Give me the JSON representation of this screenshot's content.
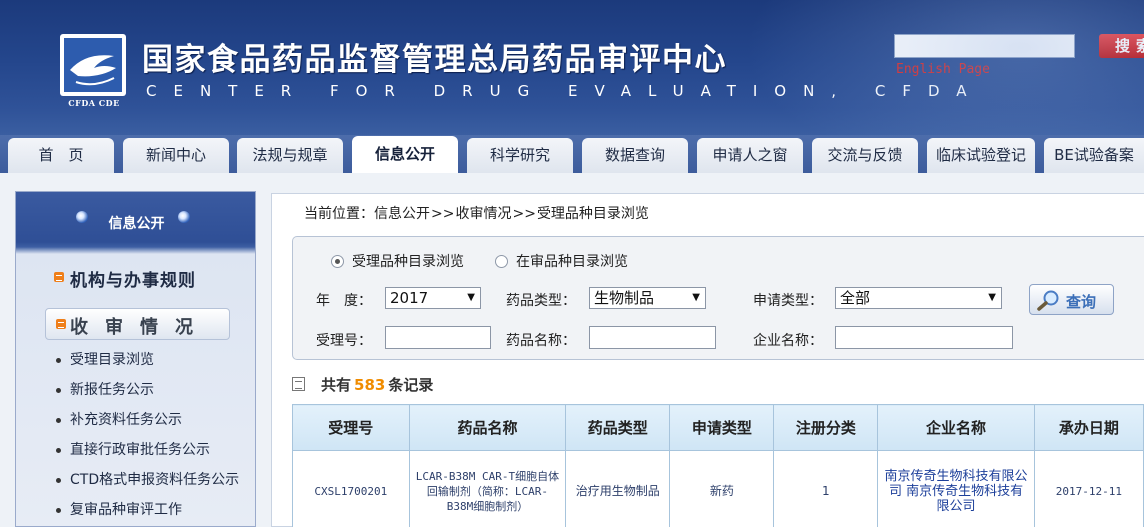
{
  "header": {
    "title": "国家食品药品监督管理总局药品审评中心",
    "subtitle": "CENTER FOR DRUG EVALUATION, CFDA",
    "logo_caption": "CFDA CDE",
    "search_placeholder": "",
    "search_button": "搜索",
    "english_link": "English Page"
  },
  "nav": {
    "items": [
      {
        "label": "首　页"
      },
      {
        "label": "新闻中心"
      },
      {
        "label": "法规与规章"
      },
      {
        "label": "信息公开"
      },
      {
        "label": "科学研究"
      },
      {
        "label": "数据查询"
      },
      {
        "label": "申请人之窗"
      },
      {
        "label": "交流与反馈"
      },
      {
        "label": "临床试验登记"
      },
      {
        "label": "BE试验备案"
      }
    ],
    "active_index": 3
  },
  "sidebar": {
    "head_title": "信息公开",
    "section_title": "机构与办事规则",
    "sub_button": "收审情况",
    "items": [
      {
        "label": "受理目录浏览"
      },
      {
        "label": "新报任务公示"
      },
      {
        "label": "补充资料任务公示"
      },
      {
        "label": "直接行政审批任务公示"
      },
      {
        "label": "CTD格式申报资料任务公示"
      },
      {
        "label": "复审品种审评工作"
      }
    ]
  },
  "breadcrumb": {
    "prefix": "当前位置：",
    "items": [
      "信息公开",
      "收审情况",
      "受理品种目录浏览"
    ],
    "separator": ">>"
  },
  "search": {
    "radio_1": "受理品种目录浏览",
    "radio_2": "在审品种目录浏览",
    "year_label": "年　度：",
    "year_value": "2017",
    "drug_type_label": "药品类型：",
    "drug_type_value": "生物制品",
    "apply_type_label": "申请类型：",
    "apply_type_value": "全部",
    "accept_no_label": "受理号：",
    "accept_no_value": "",
    "drug_name_label": "药品名称：",
    "drug_name_value": "",
    "company_label": "企业名称：",
    "company_value": "",
    "query_button": "查询"
  },
  "results": {
    "prefix": "共有",
    "count": "583",
    "suffix": "条记录"
  },
  "table": {
    "columns": [
      "受理号",
      "药品名称",
      "药品类型",
      "申请类型",
      "注册分类",
      "企业名称",
      "承办日期"
    ],
    "rows": [
      {
        "accept_no": "CXSL1700201",
        "drug_name": "LCAR-B38M CAR-T细胞自体回输制剂（简称：LCAR-B38M细胞制剂）",
        "drug_type": "治疗用生物制品",
        "apply_type": "新药",
        "reg_class": "1",
        "company": "南京传奇生物科技有限公司 南京传奇生物科技有限公司",
        "date": "2017-12-11"
      }
    ]
  },
  "colors": {
    "header_bg": "#24468c",
    "nav_bg": "#4d6dab",
    "count_highlight": "#f08c00",
    "english_link": "#e0241e"
  }
}
